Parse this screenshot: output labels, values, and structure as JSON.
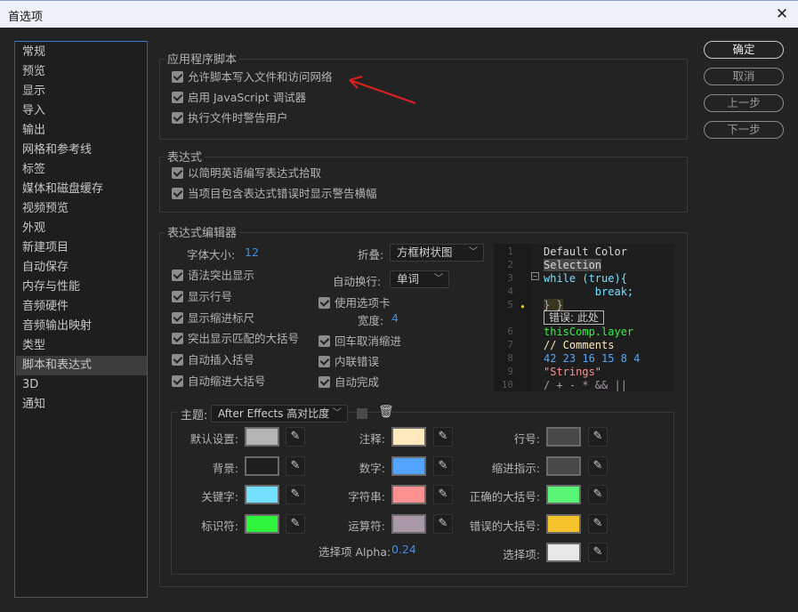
{
  "window": {
    "title": "首选项",
    "close_icon": "close-icon"
  },
  "sidebar": {
    "items": [
      "常规",
      "预览",
      "显示",
      "导入",
      "输出",
      "网格和参考线",
      "标签",
      "媒体和磁盘缓存",
      "视频预览",
      "外观",
      "新建项目",
      "自动保存",
      "内存与性能",
      "音频硬件",
      "音频输出映射",
      "类型",
      "脚本和表达式",
      "3D",
      "通知"
    ],
    "selected": "脚本和表达式"
  },
  "buttons": {
    "ok": "确定",
    "cancel": "取消",
    "prev": "上一步",
    "next": "下一步"
  },
  "app_scripting": {
    "title": "应用程序脚本",
    "options": [
      {
        "label": "允许脚本写入文件和访问网络",
        "checked": true
      },
      {
        "label": "启用 JavaScript 调试器",
        "checked": true
      },
      {
        "label": "执行文件时警告用户",
        "checked": true
      }
    ]
  },
  "expressions": {
    "title": "表达式",
    "options": [
      {
        "label": "以简明英语编写表达式拾取",
        "checked": true
      },
      {
        "label": "当项目包含表达式错误时显示警告横幅",
        "checked": true
      }
    ]
  },
  "editor": {
    "title": "表达式编辑器",
    "font_size_label": "字体大小:",
    "font_size": "12",
    "fold_label": "折叠:",
    "fold_value": "方框树状图",
    "wrap_label": "自动换行:",
    "wrap_value": "单词",
    "left_options": [
      {
        "label": "语法突出显示",
        "checked": true
      },
      {
        "label": "显示行号",
        "checked": true
      },
      {
        "label": "显示缩进标尺",
        "checked": true
      },
      {
        "label": "突出显示匹配的大括号",
        "checked": true
      },
      {
        "label": "自动插入括号",
        "checked": true
      },
      {
        "label": "自动缩进大括号",
        "checked": true
      }
    ],
    "use_tabs": {
      "label": "使用选项卡",
      "checked": true
    },
    "tab_width_label": "宽度:",
    "tab_width": "4",
    "right_options": [
      {
        "label": "回车取消缩进",
        "checked": true
      },
      {
        "label": "内联错误",
        "checked": true
      },
      {
        "label": "自动完成",
        "checked": true
      }
    ],
    "preview": {
      "line_numbers": [
        "1",
        "2",
        "3",
        "4",
        "5",
        "6",
        "7",
        "8",
        "9",
        "10"
      ],
      "lines": [
        "Default Color",
        "Selection",
        "while (true){",
        "        break;",
        "} }",
        "thisComp.layer",
        "// Comments",
        "42 23 16 15 8 4",
        "\"Strings\"",
        "/ + - * && ||"
      ],
      "error_text": "错误: 此处"
    },
    "theme": {
      "label": "主题:",
      "value": "After Effects 高对比度",
      "colors": [
        {
          "label": "默认设置:",
          "color": "#b4b4b4"
        },
        {
          "label": "背景:",
          "color": "#1e1e1e"
        },
        {
          "label": "关键字:",
          "color": "#74e0ff"
        },
        {
          "label": "标识符:",
          "color": "#2ef53c"
        },
        {
          "label": "注释:",
          "color": "#ffe9bd"
        },
        {
          "label": "数字:",
          "color": "#52a6ff"
        },
        {
          "label": "字符串:",
          "color": "#ff9090"
        },
        {
          "label": "运算符:",
          "color": "#a898a8"
        },
        {
          "label": "行号:",
          "color": "#484848"
        },
        {
          "label": "缩进指示:",
          "color": "#484848"
        },
        {
          "label": "正确的大括号:",
          "color": "#5af577"
        },
        {
          "label": "错误的大括号:",
          "color": "#f5c22b"
        },
        {
          "label": "选择项:",
          "color": "#e8e8e8"
        }
      ],
      "alpha_label": "选择项 Alpha:",
      "alpha_value": "0.24"
    }
  }
}
